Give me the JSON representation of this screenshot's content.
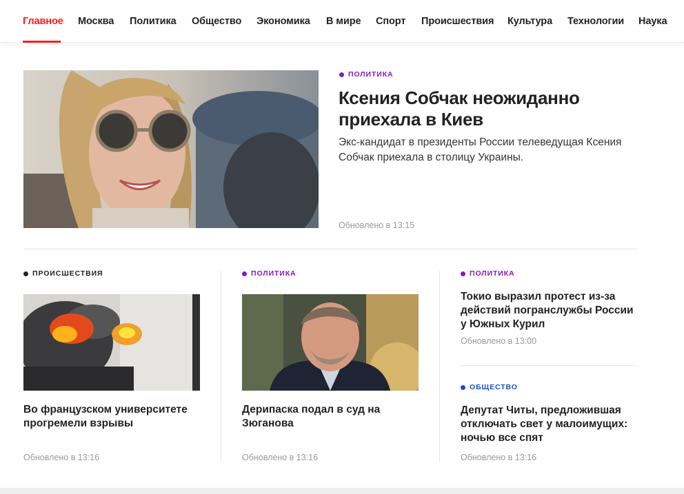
{
  "nav": {
    "items": [
      {
        "label": "Главное",
        "active": true
      },
      {
        "label": "Москва"
      },
      {
        "label": "Политика"
      },
      {
        "label": "Общество"
      },
      {
        "label": "Экономика"
      },
      {
        "label": "В мире"
      },
      {
        "label": "Спорт"
      },
      {
        "label": "Происшествия"
      },
      {
        "label": "Культура"
      },
      {
        "label": "Технологии"
      },
      {
        "label": "Наука"
      }
    ]
  },
  "colors": {
    "accent": "#ff1a1a",
    "politics": "#8a1ab8",
    "incidents": "#222222",
    "society": "#1a4fc4"
  },
  "hero": {
    "rubric": "Политика",
    "title": "Ксения Собчак неожиданно приехала в Киев",
    "lead": "Экс-кандидат в президенты России телеведущая Ксения Собчак приехала в столицу Украины.",
    "updated": "Обновлено в 13:15"
  },
  "cards": [
    {
      "rubric": "Происшествия",
      "title": "Во французском университете прогремели взрывы",
      "updated": "Обновлено в 13:16"
    },
    {
      "rubric": "Политика",
      "title": "Дерипаска подал в суд на Зюганова",
      "updated": "Обновлено в 13:16"
    }
  ],
  "side": [
    {
      "rubric": "Политика",
      "title": "Токио выразил протест из-за действий погранслужбы России у Южных Курил",
      "updated": "Обновлено в 13:00"
    },
    {
      "rubric": "Общество",
      "title": "Депутат Читы, предложившая отключать свет у малоимущих: ночью все спят",
      "updated": "Обновлено в 13:16"
    }
  ]
}
